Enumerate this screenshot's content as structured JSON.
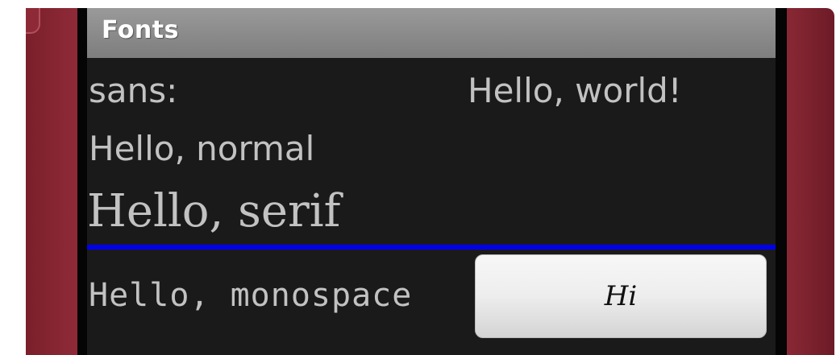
{
  "app": {
    "title": "Fonts"
  },
  "content": {
    "sans_label": "sans:",
    "sans_value": "Hello, world!",
    "normal_text": "Hello, normal",
    "serif_text": "Hello, serif",
    "monospace_text": "Hello, monospace",
    "button_label": "Hi"
  },
  "colors": {
    "divider": "#0000ee",
    "screen_background": "#1a1a1a",
    "text": "#c2c2c2",
    "phone_body": "#7b2130"
  }
}
